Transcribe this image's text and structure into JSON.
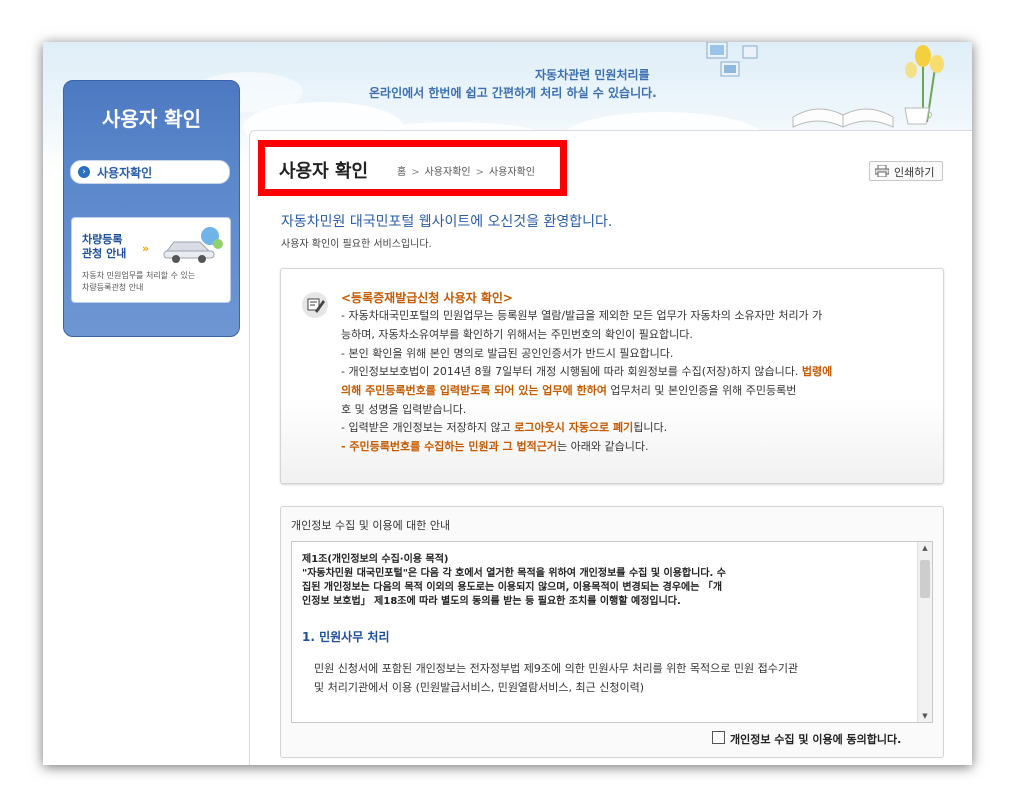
{
  "banner": {
    "line1": "자동차관련 민원처리를",
    "line2": "온라인에서 한번에 쉽고 간편하게 처리 하실 수 있습니다."
  },
  "sidebar": {
    "title": "사용자 확인",
    "active_item": "사용자확인",
    "card": {
      "title1": "차량등록",
      "title2": "관청 안내",
      "arrows": "»",
      "desc1": "자동차 민원업무를 처리할 수 있는",
      "desc2": "차량등록관청 안내"
    }
  },
  "header": {
    "page_title": "사용자 확인",
    "breadcrumb": [
      "홈",
      "사용자확인",
      "사용자확인"
    ],
    "breadcrumb_sep": ">",
    "print_label": "인쇄하기"
  },
  "welcome": {
    "title": "자동차민원 대국민포털 웹사이트에 오신것을 환영합니다.",
    "note": "사용자 확인이 필요한 서비스입니다."
  },
  "notice": {
    "title": "<등록증재발급신청 사용자 확인>",
    "l1": "- 자동차대국민포털의 민원업무는 등록원부 열람/발급을 제외한 모든 업무가 자동차의 소유자만 처리가 가",
    "l2": "능하며, 자동차소유여부를 확인하기 위해서는 주민번호의 확인이 필요합니다.",
    "l3": "- 본인 확인을 위해 본인 명의로 발급된 공인인증서가 반드시 필요합니다.",
    "l4a": "- 개인정보보호법이 2014년 8월 7일부터 개정 시행됨에 따라 회원정보를 수집(저장)하지 않습니다. ",
    "l4b": "법령에",
    "l5a": "의해 주민등록번호를 입력받도록 되어 있는 업무에 한하여",
    "l5b": " 업무처리 및 본인인증을 위해 주민등록번",
    "l6": "호 및 성명을 입력받습니다.",
    "l7a": "- 입력받은 개인정보는 저장하지 않고 ",
    "l7b": "로그아웃시 자동으로 폐기",
    "l7c": "됩니다.",
    "l8a": "- 주민등록번호를 수집하는 민원과 그 법적근거",
    "l8b": "는 아래와 같습니다."
  },
  "privacy": {
    "title": "개인정보 수집 및 이용에 대한 안내",
    "p1": "제1조(개인정보의 수집·이용 목적)",
    "p2": "\"자동차민원 대국민포털\"은 다음 각 호에서 열거한 목적을 위하여 개인정보를 수집 및 이용합니다. 수",
    "p3": "집된 개인정보는 다음의 목적 이외의 용도로는 이용되지 않으며, 이용목적이 변경되는 경우에는 「개",
    "p4": "인정보 보호법」 제18조에 따라 별도의 동의를 받는 등 필요한 조치를 이행할 예정입니다.",
    "h1": "1. 민원사무 처리",
    "b1": "민원 신청서에 포함된 개인정보는 전자정부법 제9조에 의한 민원사무 처리를 위한 목적으로 민원 접수기관",
    "b2": "및 처리기관에서 이용 (민원발급서비스, 민원열람서비스, 최근 신청이력)",
    "agree_label": "개인정보 수집 및 이용에 동의합니다."
  }
}
